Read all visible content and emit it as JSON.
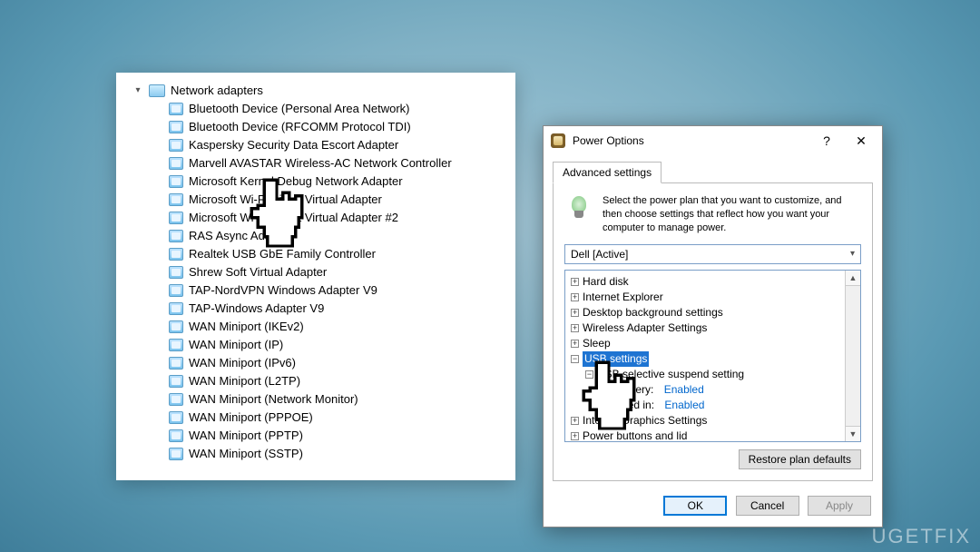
{
  "devmgr": {
    "root_label": "Network adapters",
    "items": [
      "Bluetooth Device (Personal Area Network)",
      "Bluetooth Device (RFCOMM Protocol TDI)",
      "Kaspersky Security Data Escort Adapter",
      "Marvell AVASTAR Wireless-AC Network Controller",
      "Microsoft Kernel Debug Network Adapter",
      "Microsoft Wi-Fi Direct Virtual Adapter",
      "Microsoft Wi-Fi Direct Virtual Adapter #2",
      "RAS Async Adapter",
      "Realtek USB GbE Family Controller",
      "Shrew Soft Virtual Adapter",
      "TAP-NordVPN Windows Adapter V9",
      "TAP-Windows Adapter V9",
      "WAN Miniport (IKEv2)",
      "WAN Miniport (IP)",
      "WAN Miniport (IPv6)",
      "WAN Miniport (L2TP)",
      "WAN Miniport (Network Monitor)",
      "WAN Miniport (PPPOE)",
      "WAN Miniport (PPTP)",
      "WAN Miniport (SSTP)"
    ]
  },
  "dialog": {
    "title": "Power Options",
    "help": "?",
    "close": "✕",
    "tab_label": "Advanced settings",
    "description": "Select the power plan that you want to customize, and then choose settings that reflect how you want your computer to manage power.",
    "plan_selected": "Dell [Active]",
    "tree": {
      "hard_disk": "Hard disk",
      "ie": "Internet Explorer",
      "desktop_bg": "Desktop background settings",
      "wireless": "Wireless Adapter Settings",
      "sleep": "Sleep",
      "usb_settings": "USB settings",
      "usb_suspend": "USB selective suspend setting",
      "on_battery_label": "On battery:",
      "on_battery_value": "Enabled",
      "plugged_in_label": "Plugged in:",
      "plugged_in_value": "Enabled",
      "graphics": "Intel(R) Graphics Settings",
      "buttons_lid": "Power buttons and lid"
    },
    "restore_label": "Restore plan defaults",
    "ok": "OK",
    "cancel": "Cancel",
    "apply": "Apply"
  },
  "watermark": "UGETFIX"
}
